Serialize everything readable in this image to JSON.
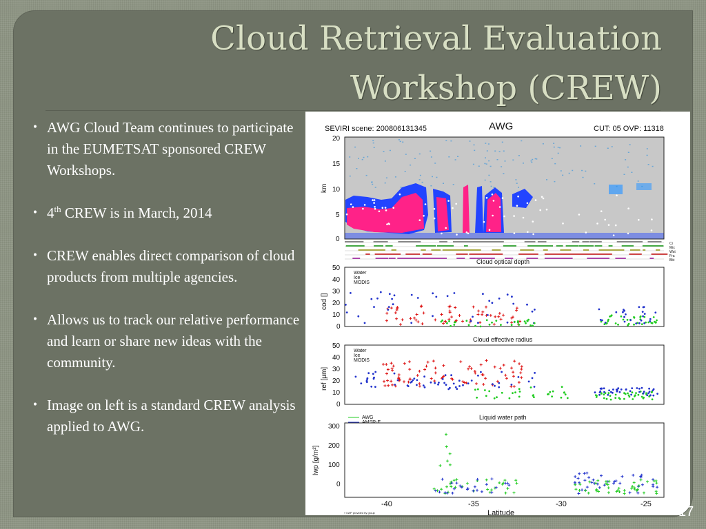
{
  "title": {
    "line1": "Cloud Retrieval Evaluation",
    "line2": "Workshop (CREW)"
  },
  "bullets": [
    {
      "text": "AWG Cloud Team continues to participate in the EUMETSAT sponsored CREW Workshops."
    },
    {
      "pre": "4",
      "sup": "th",
      "post": " CREW is in March, 2014"
    },
    {
      "text": "CREW enables direct comparison of cloud products from multiple agencies."
    },
    {
      "text": "Allows us to track our relative performance and learn or share new ideas with the community."
    },
    {
      "text": "Image on left is a standard CREW analysis applied to AWG."
    }
  ],
  "page_number": "17",
  "figure": {
    "header_left": "SEVIRI scene: 200806131345",
    "header_center": "AWG",
    "header_right": "CUT: 05   OVP: 11318",
    "panel1": {
      "ylabel": "km",
      "yticks": [
        "20",
        "15",
        "10",
        "5",
        "0"
      ],
      "flags": [
        "Ci",
        "Mix",
        "Wat",
        "Fra",
        "Bkt"
      ]
    },
    "panel2": {
      "title": "Cloud optical depth",
      "ylabel": "cod []",
      "yticks": [
        "50",
        "40",
        "30",
        "20",
        "10",
        "0"
      ],
      "legend": [
        "Water",
        "Ice",
        "MODIS"
      ]
    },
    "panel3": {
      "title": "Cloud effective radius",
      "ylabel": "ref [µm]",
      "yticks": [
        "50",
        "40",
        "30",
        "20",
        "10",
        "0"
      ],
      "legend": [
        "Water",
        "Ice",
        "MODIS"
      ]
    },
    "panel4": {
      "title": "Liquid water path",
      "ylabel": "lwp [g/m²]",
      "yticks": [
        "300",
        "200",
        "100",
        "0"
      ],
      "legend": [
        "AWG",
        "AMSR-E"
      ]
    },
    "xticks": [
      "-40",
      "-35",
      "-30",
      "-25"
    ],
    "xlabel": "Latitude",
    "footnote": "» LWP provided by group",
    "colors": {
      "water": "#22cc22",
      "ice": "#2233cc",
      "modis": "#dd1111",
      "cloud_magenta": "#ff2288",
      "cloud_blue": "#2244ff",
      "sky": "#c8c8c8"
    }
  }
}
